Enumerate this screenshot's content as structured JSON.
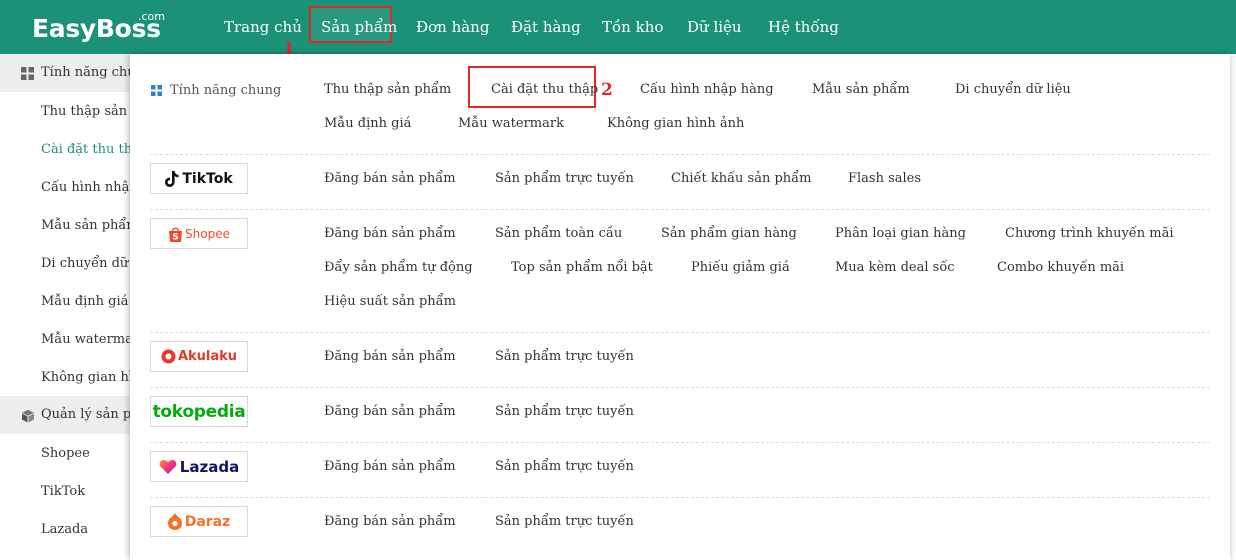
{
  "app": {
    "logo_text": "EasyBoss",
    "logo_suffix": ".com"
  },
  "nav": {
    "items": [
      {
        "label": "Trang chủ"
      },
      {
        "label": "Sản phẩm"
      },
      {
        "label": "Đơn hàng"
      },
      {
        "label": "Đặt hàng"
      },
      {
        "label": "Tồn kho"
      },
      {
        "label": "Dữ liệu"
      },
      {
        "label": "Hệ thống"
      }
    ],
    "active_index": 1
  },
  "annotations": {
    "step1": "1",
    "step2": "2",
    "highlight_color": "#e02626"
  },
  "sidebar": {
    "groups": [
      {
        "label": "Tính năng chung",
        "icon": "grid-icon"
      },
      {
        "label": "Quản lý sản phẩm",
        "icon": "box-icon"
      }
    ],
    "items": [
      {
        "label": "Thu thập sản phẩm"
      },
      {
        "label": "Cài đặt thu thập"
      },
      {
        "label": "Cấu hình nhập hàng"
      },
      {
        "label": "Mẫu sản phẩm"
      },
      {
        "label": "Di chuyển dữ liệu"
      },
      {
        "label": "Mẫu định giá"
      },
      {
        "label": "Mẫu watermark"
      },
      {
        "label": "Không gian hình ảnh"
      }
    ],
    "product_items": [
      {
        "label": "Shopee"
      },
      {
        "label": "TikTok"
      },
      {
        "label": "Lazada"
      }
    ],
    "active_label": "Cài đặt thu thập"
  },
  "menu": {
    "general": {
      "title": "Tính năng chung",
      "links": [
        "Thu thập sản phẩm",
        "Cài đặt thu thập",
        "Cấu hình nhập hàng",
        "Mẫu sản phẩm",
        "Di chuyển dữ liệu",
        "Mẫu định giá",
        "Mẫu watermark",
        "Không gian hình ảnh"
      ]
    },
    "tiktok": {
      "brand": "TikTok",
      "links": [
        "Đăng bán sản phẩm",
        "Sản phẩm trực tuyến",
        "Chiết khấu sản phẩm",
        "Flash sales"
      ]
    },
    "shopee": {
      "brand": "Shopee",
      "brand_color": "#ee4d2d",
      "links": [
        "Đăng bán sản phẩm",
        "Sản phẩm toàn cầu",
        "Sản phẩm gian hàng",
        "Phân loại gian hàng",
        "Chương trình khuyến mãi",
        "Đẩy sản phẩm tự động",
        "Top sản phẩm nổi bật",
        "Phiếu giảm giá",
        "Mua kèm deal sốc",
        "Combo khuyến mãi",
        "Hiệu suất sản phẩm"
      ]
    },
    "akulaku": {
      "brand": "Akulaku",
      "brand_color": "#e8382b",
      "links": [
        "Đăng bán sản phẩm",
        "Sản phẩm trực tuyến"
      ]
    },
    "tokopedia": {
      "brand": "tokopedia",
      "brand_color": "#03ac0e",
      "links": [
        "Đăng bán sản phẩm",
        "Sản phẩm trực tuyến"
      ]
    },
    "lazada": {
      "brand": "Lazada",
      "brand_color": "#0f146d",
      "links": [
        "Đăng bán sản phẩm",
        "Sản phẩm trực tuyến"
      ]
    },
    "daraz": {
      "brand": "Daraz",
      "brand_color": "#f57224",
      "links": [
        "Đăng bán sản phẩm",
        "Sản phẩm trực tuyến"
      ]
    }
  },
  "colors": {
    "brand_green": "#1b9277",
    "active_text": "#1b9277"
  }
}
